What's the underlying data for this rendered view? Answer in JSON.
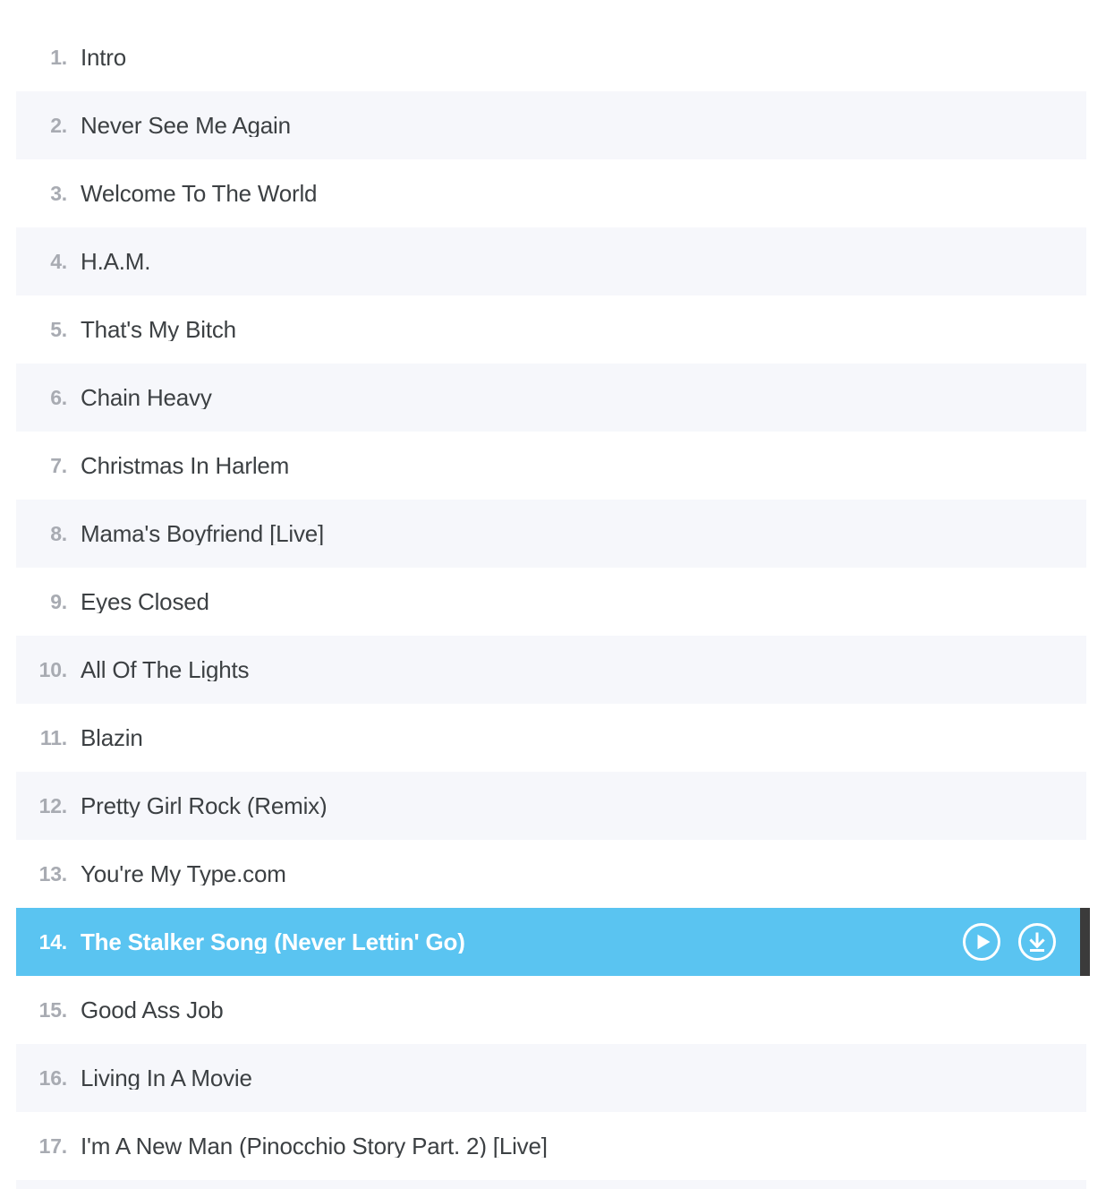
{
  "tracklist": {
    "rows": [
      {
        "number": "1.",
        "title": "Intro",
        "striped": false,
        "active": false
      },
      {
        "number": "2.",
        "title": "Never See Me Again",
        "striped": true,
        "active": false
      },
      {
        "number": "3.",
        "title": "Welcome To The World",
        "striped": false,
        "active": false
      },
      {
        "number": "4.",
        "title": "H.A.M.",
        "striped": true,
        "active": false
      },
      {
        "number": "5.",
        "title": "That's My Bitch",
        "striped": false,
        "active": false
      },
      {
        "number": "6.",
        "title": "Chain Heavy",
        "striped": true,
        "active": false
      },
      {
        "number": "7.",
        "title": "Christmas In Harlem",
        "striped": false,
        "active": false
      },
      {
        "number": "8.",
        "title": "Mama's Boyfriend [Live]",
        "striped": true,
        "active": false
      },
      {
        "number": "9.",
        "title": "Eyes Closed",
        "striped": false,
        "active": false
      },
      {
        "number": "10.",
        "title": "All Of The Lights",
        "striped": true,
        "active": false
      },
      {
        "number": "11.",
        "title": "Blazin",
        "striped": false,
        "active": false
      },
      {
        "number": "12.",
        "title": "Pretty Girl Rock (Remix)",
        "striped": true,
        "active": false
      },
      {
        "number": "13.",
        "title": "You're My Type.com",
        "striped": false,
        "active": false
      },
      {
        "number": "14.",
        "title": "The Stalker Song (Never Lettin' Go)",
        "striped": false,
        "active": true
      },
      {
        "number": "15.",
        "title": "Good Ass Job",
        "striped": false,
        "active": false
      },
      {
        "number": "16.",
        "title": "Living In A Movie",
        "striped": true,
        "active": false
      },
      {
        "number": "17.",
        "title": "I'm A New Man (Pinocchio Story Part. 2) [Live]",
        "striped": false,
        "active": false
      }
    ],
    "active_row_actions": {
      "play_icon": "play-circle-icon",
      "download_icon": "download-circle-icon"
    },
    "colors": {
      "active_background": "#5ac4f1",
      "striped_background": "#f6f7fb",
      "page_background": "#ffffff",
      "number_text": "#a8abb2",
      "title_text": "#3c4043",
      "active_text": "#ffffff",
      "active_marker": "#3b3b3b"
    }
  }
}
